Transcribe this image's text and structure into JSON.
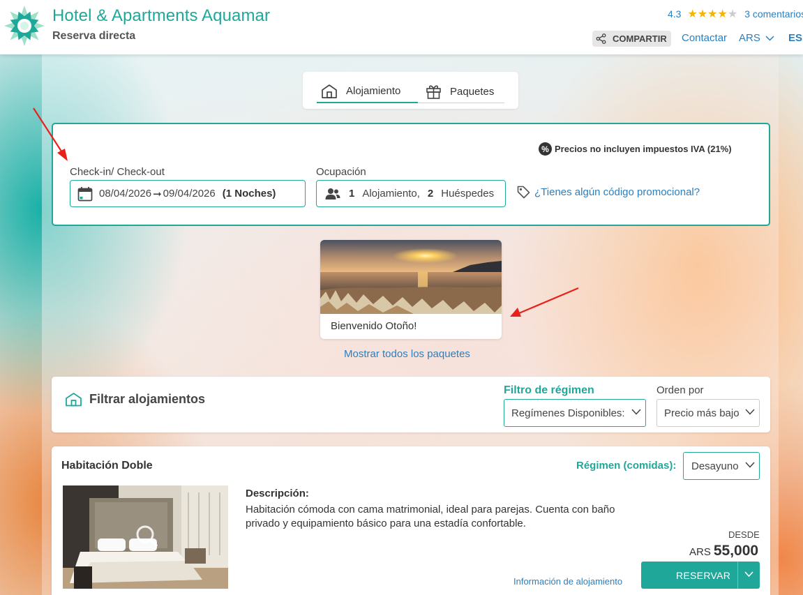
{
  "header": {
    "title": "Hotel & Apartments Aquamar",
    "subtitle": "Reserva directa",
    "rating": "4.3",
    "stars": 4.3,
    "reviews": "3 comentarios",
    "share_label": "COMPARTIR",
    "contact_label": "Contactar",
    "currency": "ARS",
    "language": "ES"
  },
  "tabs": [
    {
      "label": "Alojamiento",
      "icon": "house-icon",
      "active": true
    },
    {
      "label": "Paquetes",
      "icon": "gift-icon",
      "active": false
    }
  ],
  "search": {
    "tax_note": "Precios no incluyen impuestos IVA (21%)",
    "dates_label": "Check-in/ Check-out",
    "checkin": "08/04/2026",
    "arrow": "➞",
    "checkout": "09/04/2026",
    "nights": "(1 Noches)",
    "occupancy_label": "Ocupación",
    "rooms_count": "1",
    "rooms_label": "Alojamiento,",
    "guests_count": "2",
    "guests_label": "Huéspedes",
    "promo_label": "¿Tienes algún código promocional?"
  },
  "package": {
    "name": "Bienvenido Otoño!",
    "show_all": "Mostrar todos los paquetes"
  },
  "filters": {
    "title": "Filtrar alojamientos",
    "regime_label": "Filtro de régimen",
    "regime_value": "Regímenes Disponibles:",
    "order_label": "Orden por",
    "order_value": "Precio más bajo"
  },
  "room": {
    "title": "Habitación Doble",
    "meal_label": "Régimen (comidas):",
    "meal_value": "Desayuno",
    "desc_title": "Descripción:",
    "desc_text": "Habitación cómoda con cama matrimonial, ideal para parejas. Cuenta con baño privado y equipamiento básico para una estadía confortable.",
    "from_label": "DESDE",
    "price_currency": "ARS",
    "price_amount": "55,000",
    "info_link": "Información de alojamiento",
    "reserve_label": "RESERVAR"
  },
  "colors": {
    "brand": "#1fa89a",
    "link": "#2a7fbf",
    "annotation_arrow": "#e8211b"
  }
}
